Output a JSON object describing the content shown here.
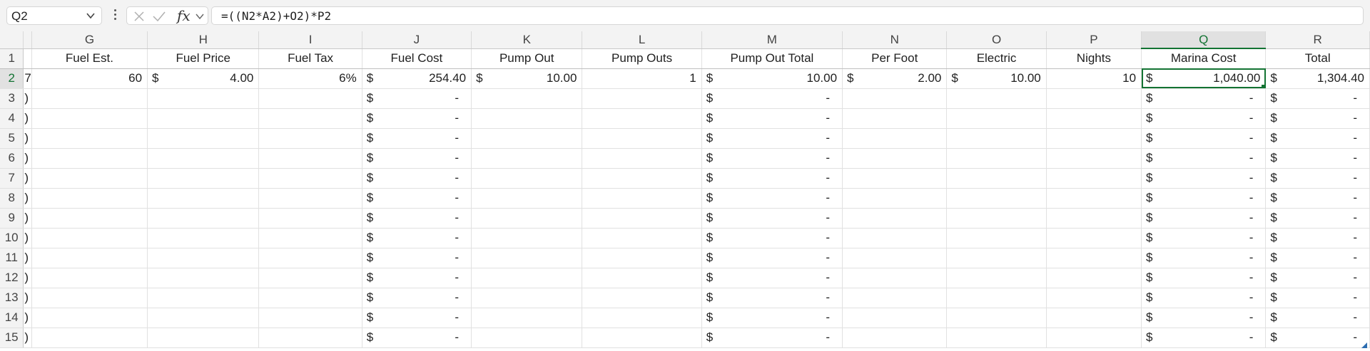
{
  "formula_bar": {
    "name_box": "Q2",
    "fx_label": "fx",
    "formula": "=((N2*A2)+O2)*P2"
  },
  "columns": [
    "G",
    "H",
    "I",
    "J",
    "K",
    "L",
    "M",
    "N",
    "O",
    "P",
    "Q",
    "R"
  ],
  "selected_column": "Q",
  "rows": [
    "1",
    "2",
    "3",
    "4",
    "5",
    "6",
    "7",
    "8",
    "9",
    "10",
    "11",
    "12",
    "13",
    "14",
    "15"
  ],
  "header_row": {
    "F": "",
    "G": "Fuel Est.",
    "H": "Fuel Price",
    "I": "Fuel Tax",
    "J": "Fuel Cost",
    "K": "Pump Out",
    "L": "Pump Outs",
    "M": "Pump Out Total",
    "N": "Per Foot",
    "O": "Electric",
    "P": "Nights",
    "Q": "Marina Cost",
    "R": "Total"
  },
  "row2": {
    "F": "7",
    "G": "60",
    "H": "4.00",
    "I": "6%",
    "J": "254.40",
    "K": "10.00",
    "L": "1",
    "M": "10.00",
    "N": "2.00",
    "O": "10.00",
    "P": "10",
    "Q": "1,040.00",
    "R": "1,304.40"
  },
  "empty_rows": {
    "F": ")",
    "currency": "$",
    "dash": "-"
  }
}
